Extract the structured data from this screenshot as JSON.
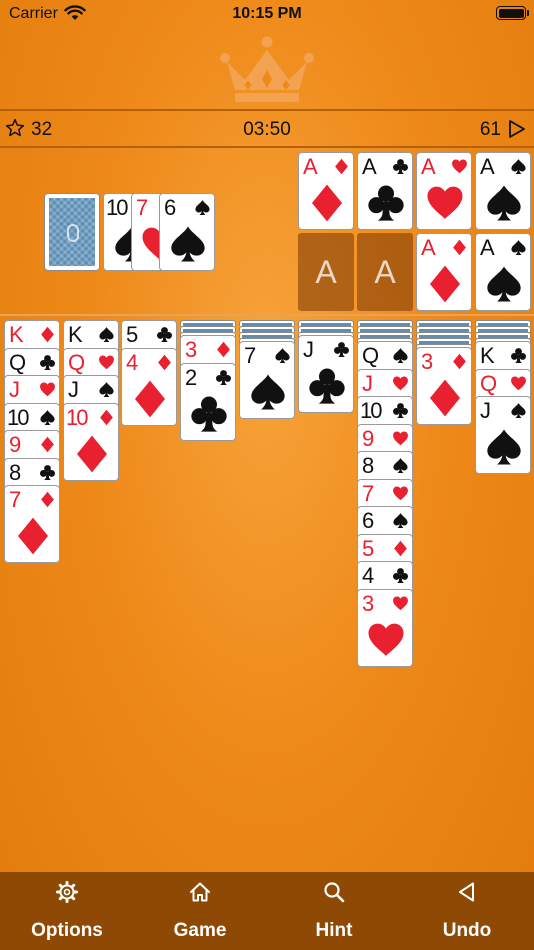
{
  "status_bar": {
    "carrier": "Carrier",
    "time": "10:15 PM"
  },
  "hud": {
    "score": "32",
    "timer": "03:50",
    "moves": "61"
  },
  "colors": {
    "background": "#ee8a1a",
    "toolbar": "#8e4a05",
    "red_suit": "#e8202f",
    "card_back": "#5d8fb5"
  },
  "stock": {
    "cards_face_down": 1
  },
  "waste": [
    {
      "rank": "10",
      "suit": "spade"
    },
    {
      "rank": "7",
      "suit": "heart"
    },
    {
      "rank": "6",
      "suit": "spade"
    }
  ],
  "foundations": {
    "top_row": [
      {
        "rank": "A",
        "suit": "diamond"
      },
      {
        "rank": "A",
        "suit": "club"
      },
      {
        "rank": "A",
        "suit": "heart"
      },
      {
        "rank": "A",
        "suit": "spade"
      }
    ],
    "bottom_row": [
      {
        "empty": true,
        "label": "A"
      },
      {
        "empty": true,
        "label": "A"
      },
      {
        "rank": "A",
        "suit": "diamond"
      },
      {
        "rank": "A",
        "suit": "spade"
      }
    ]
  },
  "tableau": [
    {
      "hidden": 0,
      "cards": [
        {
          "rank": "K",
          "suit": "diamond"
        },
        {
          "rank": "Q",
          "suit": "club"
        },
        {
          "rank": "J",
          "suit": "heart"
        },
        {
          "rank": "10",
          "suit": "spade"
        },
        {
          "rank": "9",
          "suit": "diamond"
        },
        {
          "rank": "8",
          "suit": "club"
        },
        {
          "rank": "7",
          "suit": "diamond"
        }
      ]
    },
    {
      "hidden": 0,
      "cards": [
        {
          "rank": "K",
          "suit": "spade"
        },
        {
          "rank": "Q",
          "suit": "heart"
        },
        {
          "rank": "J",
          "suit": "spade"
        },
        {
          "rank": "10",
          "suit": "diamond"
        }
      ]
    },
    {
      "hidden": 0,
      "cards": [
        {
          "rank": "5",
          "suit": "club"
        },
        {
          "rank": "4",
          "suit": "diamond"
        }
      ]
    },
    {
      "hidden": 3,
      "cards": [
        {
          "rank": "3",
          "suit": "diamond"
        },
        {
          "rank": "2",
          "suit": "club"
        }
      ]
    },
    {
      "hidden": 4,
      "cards": [
        {
          "rank": "7",
          "suit": "spade"
        }
      ]
    },
    {
      "hidden": 3,
      "cards": [
        {
          "rank": "J",
          "suit": "club"
        }
      ]
    },
    {
      "hidden": 4,
      "cards": [
        {
          "rank": "Q",
          "suit": "spade"
        },
        {
          "rank": "J",
          "suit": "heart"
        },
        {
          "rank": "10",
          "suit": "club"
        },
        {
          "rank": "9",
          "suit": "heart"
        },
        {
          "rank": "8",
          "suit": "spade"
        },
        {
          "rank": "7",
          "suit": "heart"
        },
        {
          "rank": "6",
          "suit": "spade"
        },
        {
          "rank": "5",
          "suit": "diamond"
        },
        {
          "rank": "4",
          "suit": "club"
        },
        {
          "rank": "3",
          "suit": "heart"
        }
      ]
    },
    {
      "hidden": 5,
      "cards": [
        {
          "rank": "3",
          "suit": "diamond"
        }
      ]
    },
    {
      "hidden": 4,
      "cards": [
        {
          "rank": "K",
          "suit": "club"
        },
        {
          "rank": "Q",
          "suit": "heart"
        },
        {
          "rank": "J",
          "suit": "spade"
        }
      ]
    }
  ],
  "toolbar": {
    "options": {
      "label": "Options",
      "icon": "gear-icon"
    },
    "game": {
      "label": "Game",
      "icon": "home-icon"
    },
    "hint": {
      "label": "Hint",
      "icon": "magnifier-icon"
    },
    "undo": {
      "label": "Undo",
      "icon": "back-triangle-icon"
    }
  }
}
